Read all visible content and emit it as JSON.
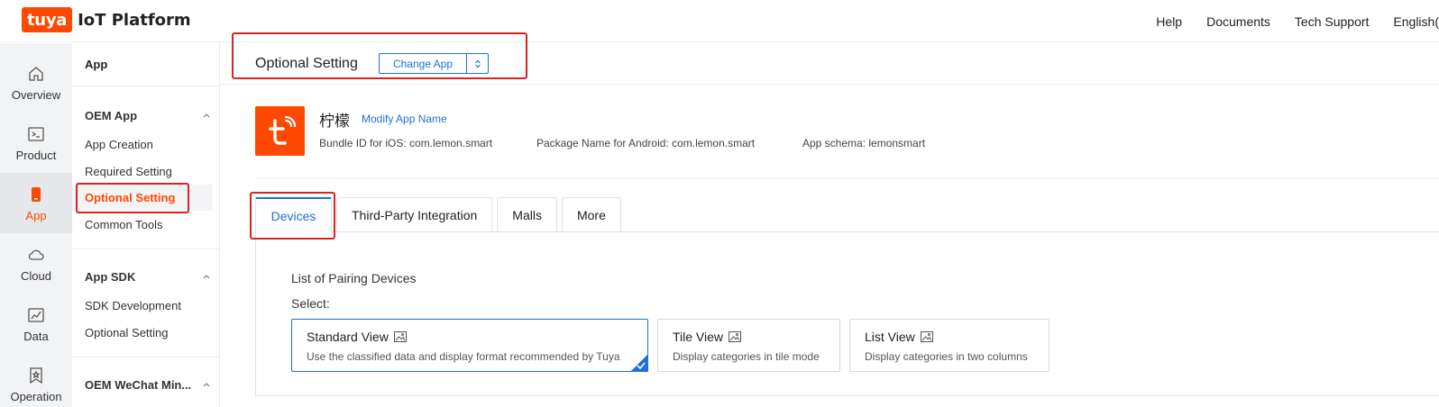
{
  "header": {
    "logo_text": "tuya",
    "title": "IoT Platform",
    "nav": [
      "Help",
      "Documents",
      "Tech Support",
      "English("
    ]
  },
  "rail": {
    "items": [
      {
        "label": "Overview",
        "icon": "home-icon"
      },
      {
        "label": "Product",
        "icon": "terminal-icon"
      },
      {
        "label": "App",
        "icon": "phone-icon",
        "active": true
      },
      {
        "label": "Cloud",
        "icon": "cloud-icon"
      },
      {
        "label": "Data",
        "icon": "chart-icon"
      },
      {
        "label": "Operation",
        "icon": "badge-icon"
      }
    ]
  },
  "menu": {
    "head": "App",
    "groups": [
      {
        "label": "OEM App",
        "items": [
          "App Creation",
          "Required Setting",
          "Optional Setting",
          "Common Tools"
        ]
      },
      {
        "label": "App SDK",
        "items": [
          "SDK Development",
          "Optional Setting"
        ]
      },
      {
        "label": "OEM WeChat Min..."
      }
    ]
  },
  "main": {
    "page_title": "Optional Setting",
    "change_app": "Change App",
    "app": {
      "name": "柠檬",
      "modify": "Modify App Name",
      "bundle": "Bundle ID for iOS: com.lemon.smart",
      "package": "Package Name for Android: com.lemon.smart",
      "schema": "App schema: lemonsmart"
    },
    "tabs": [
      "Devices",
      "Third-Party Integration",
      "Malls",
      "More"
    ],
    "panel": {
      "title": "List of Pairing Devices",
      "select": "Select:",
      "views": [
        {
          "title": "Standard View",
          "desc": "Use the classified data and display format recommended by Tuya",
          "selected": true
        },
        {
          "title": "Tile View",
          "desc": "Display categories in tile mode"
        },
        {
          "title": "List View",
          "desc": "Display categories in two columns"
        }
      ]
    }
  },
  "colors": {
    "brand": "#ff4800",
    "link": "#1e6fd9",
    "highlight": "#e02020"
  }
}
